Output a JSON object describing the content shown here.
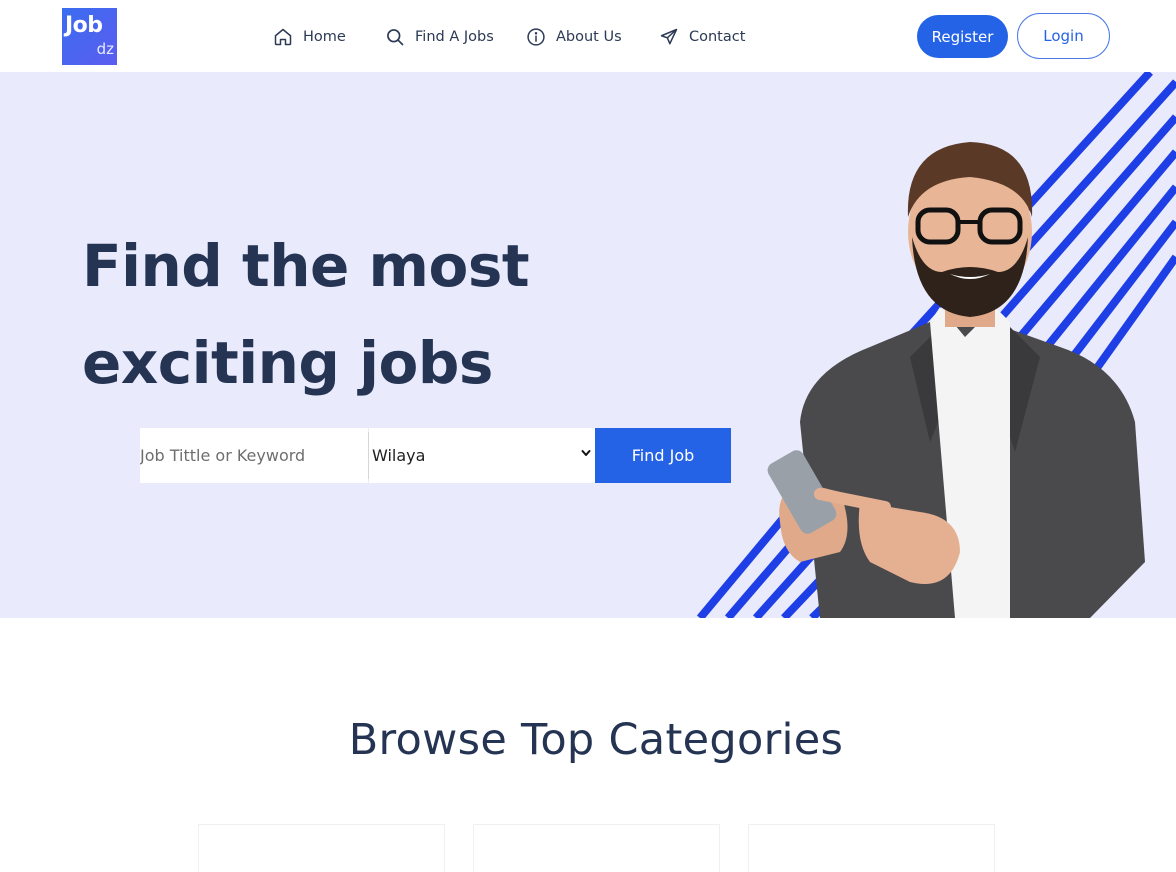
{
  "brand": {
    "logo_main": "Job",
    "logo_sub": "dz"
  },
  "nav": {
    "items": [
      {
        "label": "Home",
        "icon": "home-icon"
      },
      {
        "label": "Find A Jobs",
        "icon": "search-icon"
      },
      {
        "label": "About Us",
        "icon": "info-icon"
      },
      {
        "label": "Contact",
        "icon": "paper-plane-icon"
      }
    ]
  },
  "auth": {
    "register_label": "Register",
    "login_label": "Login"
  },
  "hero": {
    "title_line1": "Find the most",
    "title_line2": "exciting jobs"
  },
  "search": {
    "keyword_placeholder": "Job Tittle or Keyword",
    "wilaya_selected": "Wilaya",
    "submit_label": "Find Job"
  },
  "categories": {
    "title": "Browse Top Categories"
  },
  "colors": {
    "accent": "#2563e6",
    "hero_bg": "#e9ebfd",
    "heading": "#243452",
    "stripes": "#1f3fe6"
  }
}
